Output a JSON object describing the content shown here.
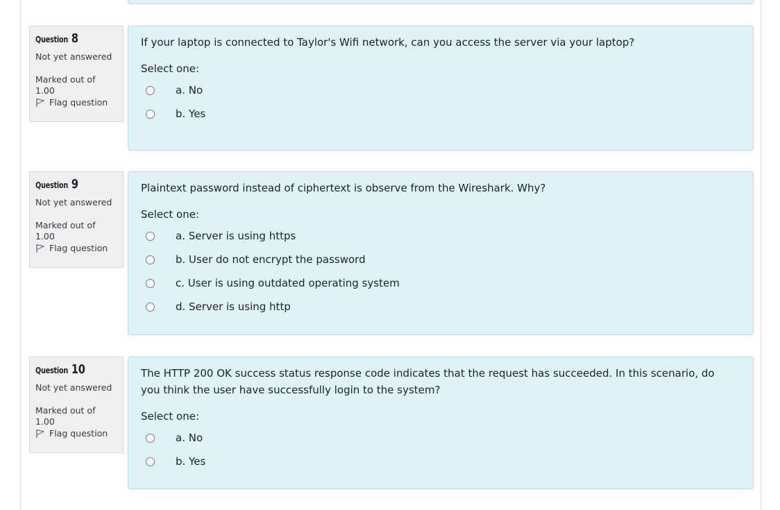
{
  "questions": [
    {
      "label": "Question",
      "number": "8",
      "status": "Not yet answered",
      "marks": "Marked out of 1.00",
      "flag_label": "Flag question",
      "text": "If your laptop is connected to Taylor's Wifi network, can you access the server via your laptop?",
      "prompt": "Select one:",
      "answers": [
        "a. No",
        "b. Yes"
      ]
    },
    {
      "label": "Question",
      "number": "9",
      "status": "Not yet answered",
      "marks": "Marked out of 1.00",
      "flag_label": "Flag question",
      "text": "Plaintext password instead of ciphertext is observe from the Wireshark. Why?",
      "prompt": "Select one:",
      "answers": [
        "a. Server is using https",
        "b. User do not encrypt the password",
        "c. User is using outdated operating system",
        "d. Server is using http"
      ]
    },
    {
      "label": "Question",
      "number": "10",
      "status": "Not yet answered",
      "marks": "Marked out of 1.00",
      "flag_label": "Flag question",
      "text": "The HTTP 200 OK success status response code indicates that the request has succeeded. In this scenario, do you think the user have successfully login to the system?",
      "prompt": "Select one:",
      "answers": [
        "a. No",
        "b. Yes"
      ]
    }
  ],
  "colors": {
    "content_bg": "#def2f8",
    "content_border": "#b6dbe8",
    "info_bg": "#f0f0f0"
  }
}
